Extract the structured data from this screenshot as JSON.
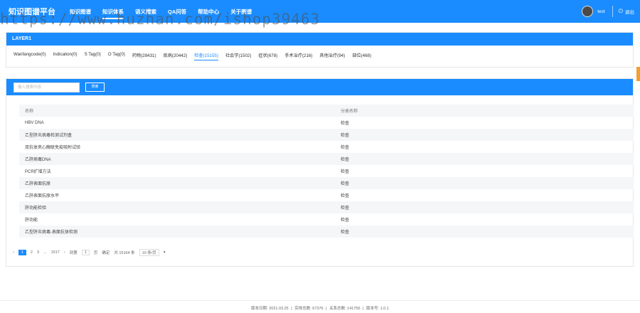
{
  "nav": {
    "brand": "知识图谱平台",
    "items": [
      "知识图谱",
      "知识体系",
      "语义搜索",
      "QA问答",
      "帮助中心",
      "关于图谱"
    ],
    "user": "test",
    "logout": "退出"
  },
  "watermark": "https://www.huzhan.com/ishop39463",
  "layer": {
    "title": "LAYER1",
    "tags": [
      "Wanfangcode(0)",
      "Indication(0)",
      "S Tag(0)",
      "O Tag(0)",
      "药物(28431)",
      "疾病(20442)",
      "检查(15155)",
      "社会学(1502)",
      "症状(678)",
      "手术治疗(216)",
      "其他治疗(94)",
      "部位(468)"
    ]
  },
  "search": {
    "placeholder": "输入搜索内容",
    "button": "搜索"
  },
  "table": {
    "headers": [
      "名称",
      "分类名称"
    ],
    "rows": [
      [
        "HBV DNA",
        "检查"
      ],
      [
        "乙型肝炎病毒检测试剂盒",
        "检查"
      ],
      [
        "双抗体夹心酶联免疫吸附试验",
        "检查"
      ],
      [
        "乙肝病毒DNA",
        "检查"
      ],
      [
        "PCR扩增方法",
        "检查"
      ],
      [
        "乙肝表面抗原",
        "检查"
      ],
      [
        "乙肝表面抗原水平",
        "检查"
      ],
      [
        "肝功能检验",
        "检查"
      ],
      [
        "肝功能",
        "检查"
      ],
      [
        "乙型肝炎病毒-表面抗体检测",
        "检查"
      ]
    ]
  },
  "pager": {
    "prev": "‹",
    "pages": [
      "1",
      "2",
      "3",
      "...",
      "1517"
    ],
    "next": "›",
    "goto": "到第",
    "input": "1",
    "unit": "页",
    "confirm": "确定",
    "total": "共 15164 条",
    "size": "10 条/页"
  },
  "footer": [
    "版本日期: 2021.03.25",
    "实体总数: 67376",
    "关系总数: 141755",
    "版本号: 1.0.1"
  ]
}
